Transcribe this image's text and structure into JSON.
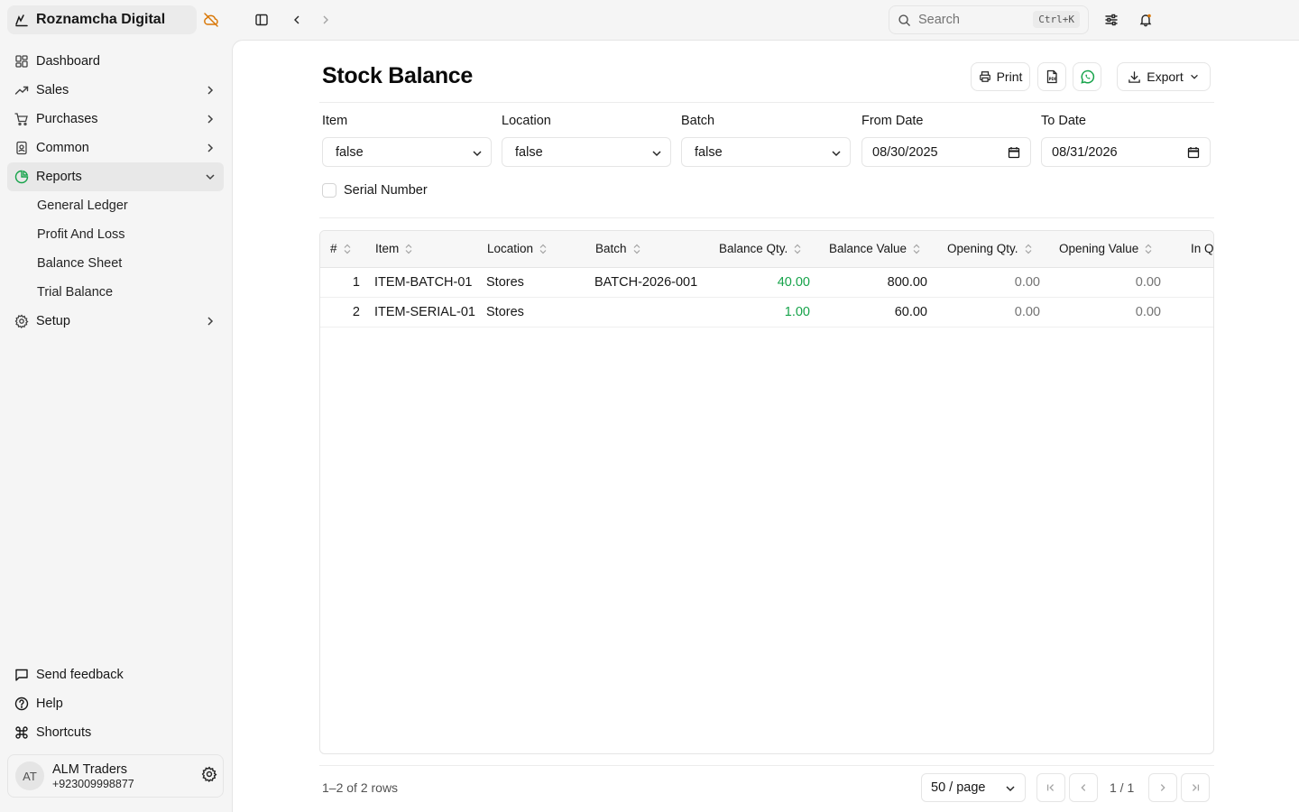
{
  "app": {
    "name": "Roznamcha Digital"
  },
  "topbar": {
    "search_placeholder": "Search",
    "search_shortcut": "Ctrl+K"
  },
  "sidebar": {
    "items": [
      {
        "label": "Dashboard"
      },
      {
        "label": "Sales"
      },
      {
        "label": "Purchases"
      },
      {
        "label": "Common"
      },
      {
        "label": "Reports"
      },
      {
        "label": "Setup"
      }
    ],
    "reports_sub": [
      {
        "label": "General Ledger"
      },
      {
        "label": "Profit And Loss"
      },
      {
        "label": "Balance Sheet"
      },
      {
        "label": "Trial Balance"
      }
    ],
    "bottom": [
      {
        "label": "Send feedback"
      },
      {
        "label": "Help"
      },
      {
        "label": "Shortcuts"
      }
    ],
    "user": {
      "initials": "AT",
      "name": "ALM Traders",
      "phone": "+923009998877"
    }
  },
  "page": {
    "title": "Stock Balance",
    "print_label": "Print",
    "export_label": "Export"
  },
  "filters": {
    "item": {
      "label": "Item",
      "value": "false"
    },
    "location": {
      "label": "Location",
      "value": "false"
    },
    "batch": {
      "label": "Batch",
      "value": "false"
    },
    "from_date": {
      "label": "From Date",
      "value": "08/30/2025"
    },
    "to_date": {
      "label": "To Date",
      "value": "08/31/2026"
    },
    "serial_number": {
      "label": "Serial Number",
      "checked": false
    }
  },
  "table": {
    "columns": [
      "#",
      "Item",
      "Location",
      "Batch",
      "Balance Qty.",
      "Balance Value",
      "Opening Qty.",
      "Opening Value",
      "In Qt"
    ],
    "rows": [
      {
        "idx": "1",
        "item": "ITEM-BATCH-01",
        "location": "Stores",
        "batch": "BATCH-2026-001",
        "balance_qty": "40.00",
        "balance_value": "800.00",
        "opening_qty": "0.00",
        "opening_value": "0.00"
      },
      {
        "idx": "2",
        "item": "ITEM-SERIAL-01",
        "location": "Stores",
        "batch": "",
        "balance_qty": "1.00",
        "balance_value": "60.00",
        "opening_qty": "0.00",
        "opening_value": "0.00"
      }
    ]
  },
  "footer": {
    "rows_text": "1–2 of 2 rows",
    "page_size": "50 / page",
    "page_indicator": "1 / 1"
  },
  "colors": {
    "accent_orange": "#d97706",
    "positive_green": "#16a34a",
    "whatsapp_green": "#16a34a"
  }
}
